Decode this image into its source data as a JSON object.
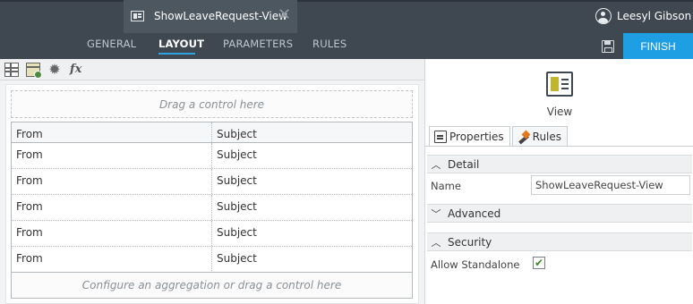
{
  "document": {
    "title": "ShowLeaveRequest-View",
    "close_glyph": "✕"
  },
  "user": {
    "name": "Leesyl Gibson"
  },
  "nav": {
    "tabs": [
      {
        "label": "GENERAL"
      },
      {
        "label": "LAYOUT"
      },
      {
        "label": "PARAMETERS"
      },
      {
        "label": "RULES"
      }
    ],
    "active_tab": "LAYOUT",
    "finish_label": "FINISH"
  },
  "toolbar": {
    "icons": [
      "grid-icon",
      "table-icon",
      "gear-icon",
      "fx-icon"
    ],
    "fx_label": "fx",
    "gear_glyph": "✹"
  },
  "canvas": {
    "drop_hint": "Drag a control here",
    "list": {
      "headers": [
        "From",
        "Subject"
      ],
      "rows": [
        [
          "From",
          "Subject"
        ],
        [
          "From",
          "Subject"
        ],
        [
          "From",
          "Subject"
        ],
        [
          "From",
          "Subject"
        ],
        [
          "From",
          "Subject"
        ]
      ]
    },
    "aggregation_hint": "Configure an aggregation or drag a control here"
  },
  "panel": {
    "object_type": "View",
    "tabs": [
      {
        "label": "Properties",
        "icon": "properties-icon"
      },
      {
        "label": "Rules",
        "icon": "rules-icon"
      }
    ],
    "sections": [
      {
        "title": "Detail",
        "state": "expanded"
      },
      {
        "title": "Advanced",
        "state": "collapsed"
      },
      {
        "title": "Security",
        "state": "expanded"
      }
    ],
    "detail": {
      "name_label": "Name",
      "name_value": "ShowLeaveRequest-View"
    },
    "security": {
      "allow_standalone_label": "Allow Standalone",
      "allow_standalone": true,
      "check_glyph": "✔"
    }
  },
  "colors": {
    "topbar": "#3f4851",
    "accent": "#1e9fe3",
    "view_icon": "#c1b52c"
  }
}
